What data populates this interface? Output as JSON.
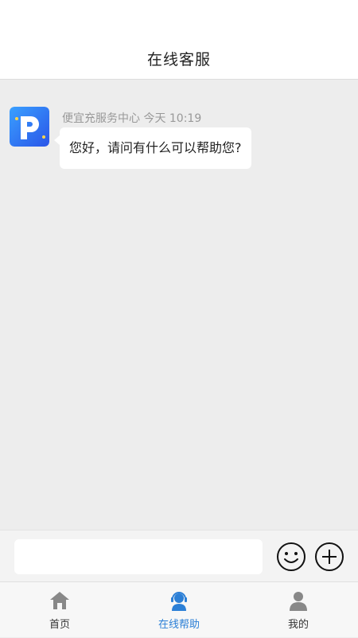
{
  "header": {
    "title": "在线客服"
  },
  "chat": {
    "messages": [
      {
        "sender": "便宜充服务中心",
        "time": "今天 10:19",
        "text": "您好，请问有什么可以帮助您?",
        "avatar_icon": "app-logo-icon"
      }
    ]
  },
  "input": {
    "value": "",
    "placeholder": "",
    "emoji_icon": "smiley-icon",
    "plus_icon": "plus-circle-icon"
  },
  "tabbar": {
    "active_color": "#2b7fd6",
    "inactive_color": "#888888",
    "tabs": [
      {
        "label": "首页",
        "icon": "home-icon",
        "active": false
      },
      {
        "label": "在线帮助",
        "icon": "headset-icon",
        "active": true
      },
      {
        "label": "我的",
        "icon": "user-icon",
        "active": false
      }
    ]
  }
}
